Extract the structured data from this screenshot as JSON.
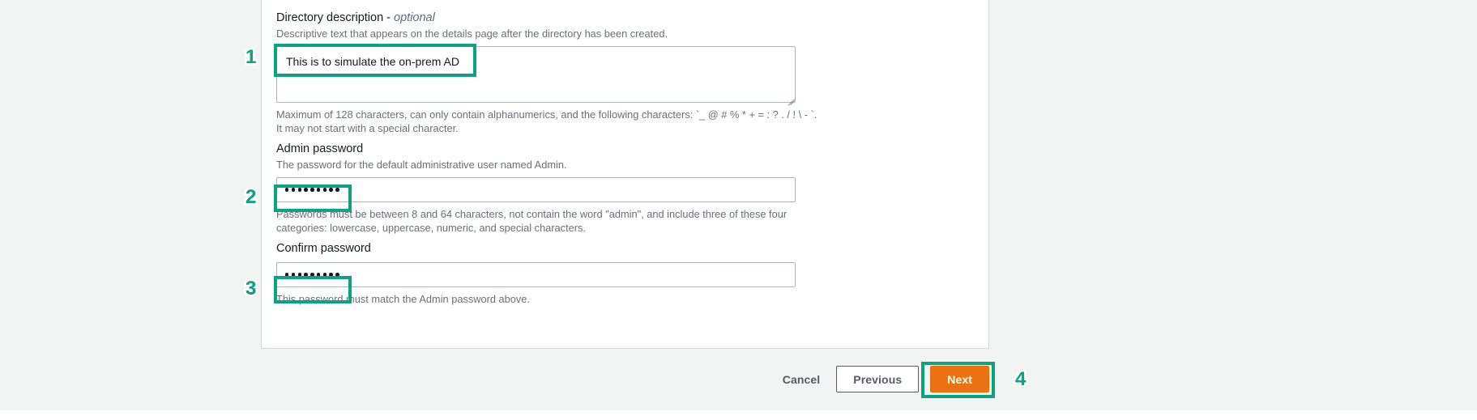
{
  "form": {
    "fields": [
      {
        "id": "directory-description",
        "label": "Directory description -",
        "optional_tag": "optional",
        "description": "Descriptive text that appears on the details page after the directory has been created.",
        "value": "This is to simulate the on-prem AD",
        "hint_lines": [
          "Maximum of 128 characters, can only contain alphanumerics, and the following characters: `_ @ # % * + = : ? . / ! \\ - `.",
          "It may not start with a special character."
        ]
      },
      {
        "id": "admin-password",
        "label": "Admin password",
        "description": "The password for the default administrative user named Admin.",
        "value": "•••••••••",
        "dot_count": 9,
        "hint_lines": [
          "Passwords must be between 8 and 64 characters, not contain the word \"admin\", and include three of these four",
          "categories: lowercase, uppercase, numeric, and special characters."
        ]
      },
      {
        "id": "confirm-password",
        "label": "Confirm password",
        "description": "",
        "value": "•••••••••",
        "dot_count": 9,
        "hint_lines": [
          "This password must match the Admin password above."
        ]
      }
    ]
  },
  "footer": {
    "cancel_label": "Cancel",
    "previous_label": "Previous",
    "next_label": "Next"
  },
  "annotations": {
    "markers": [
      "1",
      "2",
      "3",
      "4"
    ],
    "highlight_color": "#0ca37e"
  },
  "colors": {
    "primary_button": "#ec7211",
    "annotation_teal": "#0ca37e",
    "page_background": "#f2f3f3",
    "card_background": "#ffffff",
    "label_text": "#16191f",
    "muted_text": "#687078",
    "border": "#aab7b8"
  }
}
